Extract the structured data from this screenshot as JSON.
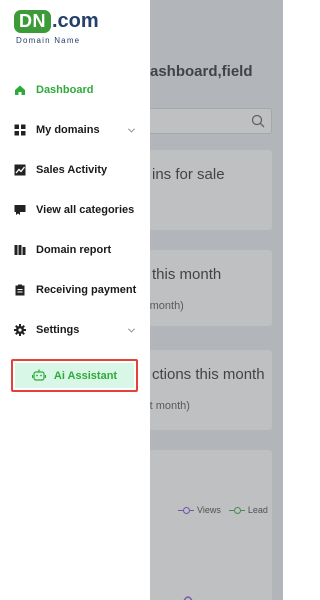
{
  "logo": {
    "mark": "DN",
    "domain": ".com",
    "subtitle": "Domain Name"
  },
  "nav": [
    {
      "label": "Dashboard",
      "icon": "home-icon",
      "active": true
    },
    {
      "label": "My domains",
      "icon": "grid-icon",
      "expandable": true
    },
    {
      "label": "Sales Activity",
      "icon": "chart-line-icon"
    },
    {
      "label": "View all categories",
      "icon": "category-icon"
    },
    {
      "label": "Domain report",
      "icon": "report-icon"
    },
    {
      "label": "Receiving payment",
      "icon": "clipboard-icon"
    },
    {
      "label": "Settings",
      "icon": "gear-icon",
      "expandable": true
    }
  ],
  "ai_assistant": {
    "label": "Ai Assistant",
    "icon": "robot-icon"
  },
  "background": {
    "title": "ashboard,field",
    "cards": [
      {
        "big": "ins for sale",
        "small": ""
      },
      {
        "big": "this month",
        "small": "st month)"
      },
      {
        "big": "ctions this month",
        "small": "ast month)"
      }
    ],
    "legend": [
      "Views",
      "Lead"
    ]
  },
  "colors": {
    "brand_green": "#2faa3a",
    "brand_navy": "#24406b",
    "highlight_red": "#e5413b",
    "ai_bg": "#d8f7e6"
  }
}
